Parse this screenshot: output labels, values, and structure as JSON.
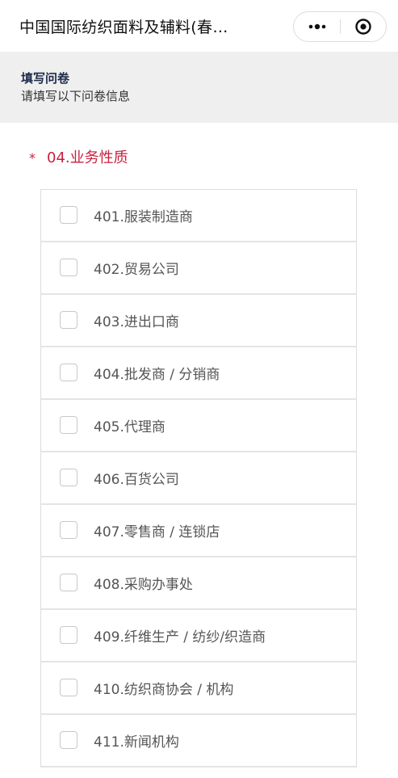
{
  "topbar": {
    "title": "中国国际纺织面料及辅料(春…",
    "more_icon": "more-dots-icon",
    "close_icon": "target-close-icon"
  },
  "header": {
    "title": "填写问卷",
    "subtitle": "请填写以下问卷信息"
  },
  "question": {
    "required_mark": "*",
    "label": "04.业务性质",
    "required_color": "#c8203f"
  },
  "options": [
    {
      "label": "401.服装制造商",
      "checked": false
    },
    {
      "label": "402.贸易公司",
      "checked": false
    },
    {
      "label": "403.进出口商",
      "checked": false
    },
    {
      "label": "404.批发商 / 分销商",
      "checked": false
    },
    {
      "label": "405.代理商",
      "checked": false
    },
    {
      "label": "406.百货公司",
      "checked": false
    },
    {
      "label": "407.零售商 / 连锁店",
      "checked": false
    },
    {
      "label": "408.采购办事处",
      "checked": false
    },
    {
      "label": "409.纤维生产 / 纺纱/织造商",
      "checked": false
    },
    {
      "label": "410.纺织商协会 / 机构",
      "checked": false
    },
    {
      "label": "411.新闻机构",
      "checked": false
    }
  ]
}
